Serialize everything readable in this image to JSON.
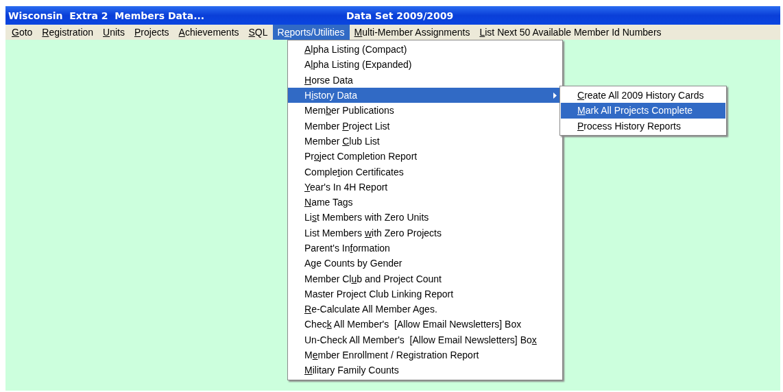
{
  "window": {
    "title": "Wisconsin  Extra 2  Members Data...",
    "dataset": "Data Set 2009/2009"
  },
  "menubar": [
    {
      "key": "G",
      "post": "oto",
      "selected": false
    },
    {
      "key": "R",
      "post": "egistration",
      "selected": false
    },
    {
      "key": "U",
      "post": "nits",
      "selected": false
    },
    {
      "key": "P",
      "post": "rojects",
      "selected": false
    },
    {
      "key": "A",
      "post": "chievements",
      "selected": false
    },
    {
      "key": "S",
      "post": "QL",
      "selected": false
    },
    {
      "pre": "R",
      "key": "e",
      "post": "ports/Utilities",
      "selected": true
    },
    {
      "key": "M",
      "post": "ulti-Member Assignments",
      "selected": false
    },
    {
      "key": "L",
      "post": "ist Next 50 Available Member Id Numbers",
      "selected": false
    }
  ],
  "menu": [
    {
      "key": "A",
      "post": "lpha Listing (Compact)",
      "selected": false,
      "submenu": false
    },
    {
      "pre": "A",
      "key": "l",
      "post": "pha Listing (Expanded)",
      "selected": false,
      "submenu": false
    },
    {
      "key": "H",
      "post": "orse Data",
      "selected": false,
      "submenu": false
    },
    {
      "pre": "H",
      "key": "i",
      "post": "story Data",
      "selected": true,
      "submenu": true
    },
    {
      "pre": "Mem",
      "key": "b",
      "post": "er Publications",
      "selected": false,
      "submenu": false
    },
    {
      "pre": "Member ",
      "key": "P",
      "post": "roject List",
      "selected": false,
      "submenu": false
    },
    {
      "pre": "Member ",
      "key": "C",
      "post": "lub List",
      "selected": false,
      "submenu": false
    },
    {
      "pre": "Pr",
      "key": "o",
      "post": "ject Completion Report",
      "selected": false,
      "submenu": false
    },
    {
      "pre": "Comple",
      "key": "t",
      "post": "ion Certificates",
      "selected": false,
      "submenu": false
    },
    {
      "key": "Y",
      "post": "ear's In 4H Report",
      "selected": false,
      "submenu": false
    },
    {
      "key": "N",
      "post": "ame Tags",
      "selected": false,
      "submenu": false
    },
    {
      "pre": "Li",
      "key": "s",
      "post": "t Members with Zero Units",
      "selected": false,
      "submenu": false
    },
    {
      "pre": "List Members ",
      "key": "w",
      "post": "ith Zero Projects",
      "selected": false,
      "submenu": false
    },
    {
      "pre": "Parent's In",
      "key": "f",
      "post": "ormation",
      "selected": false,
      "submenu": false
    },
    {
      "pre": "A",
      "key": "g",
      "post": "e Counts by Gender",
      "selected": false,
      "submenu": false
    },
    {
      "pre": "Member Cl",
      "key": "u",
      "post": "b and Project Count",
      "selected": false,
      "submenu": false
    },
    {
      "pre": "Master Project Club Linking Report",
      "selected": false,
      "submenu": false
    },
    {
      "key": "R",
      "post": "e-Calculate All Member Ages.",
      "selected": false,
      "submenu": false
    },
    {
      "pre": "Chec",
      "key": "k",
      "post": " All Member's  [Allow Email Newsletters] Box",
      "selected": false,
      "submenu": false
    },
    {
      "pre": "Un-Check All Member's  [Allow Email Newsletters] Bo",
      "key": "x",
      "selected": false,
      "submenu": false
    },
    {
      "pre": "M",
      "key": "e",
      "post": "mber Enrollment / Registration Report",
      "selected": false,
      "submenu": false
    },
    {
      "key": "M",
      "post": "ilitary Family Counts",
      "selected": false,
      "submenu": false
    }
  ],
  "submenu": [
    {
      "key": "C",
      "post": "reate All 2009 History Cards",
      "selected": false
    },
    {
      "key": "M",
      "post": "ark All Projects Complete",
      "selected": true
    },
    {
      "key": "P",
      "post": "rocess History Reports",
      "selected": false
    }
  ]
}
